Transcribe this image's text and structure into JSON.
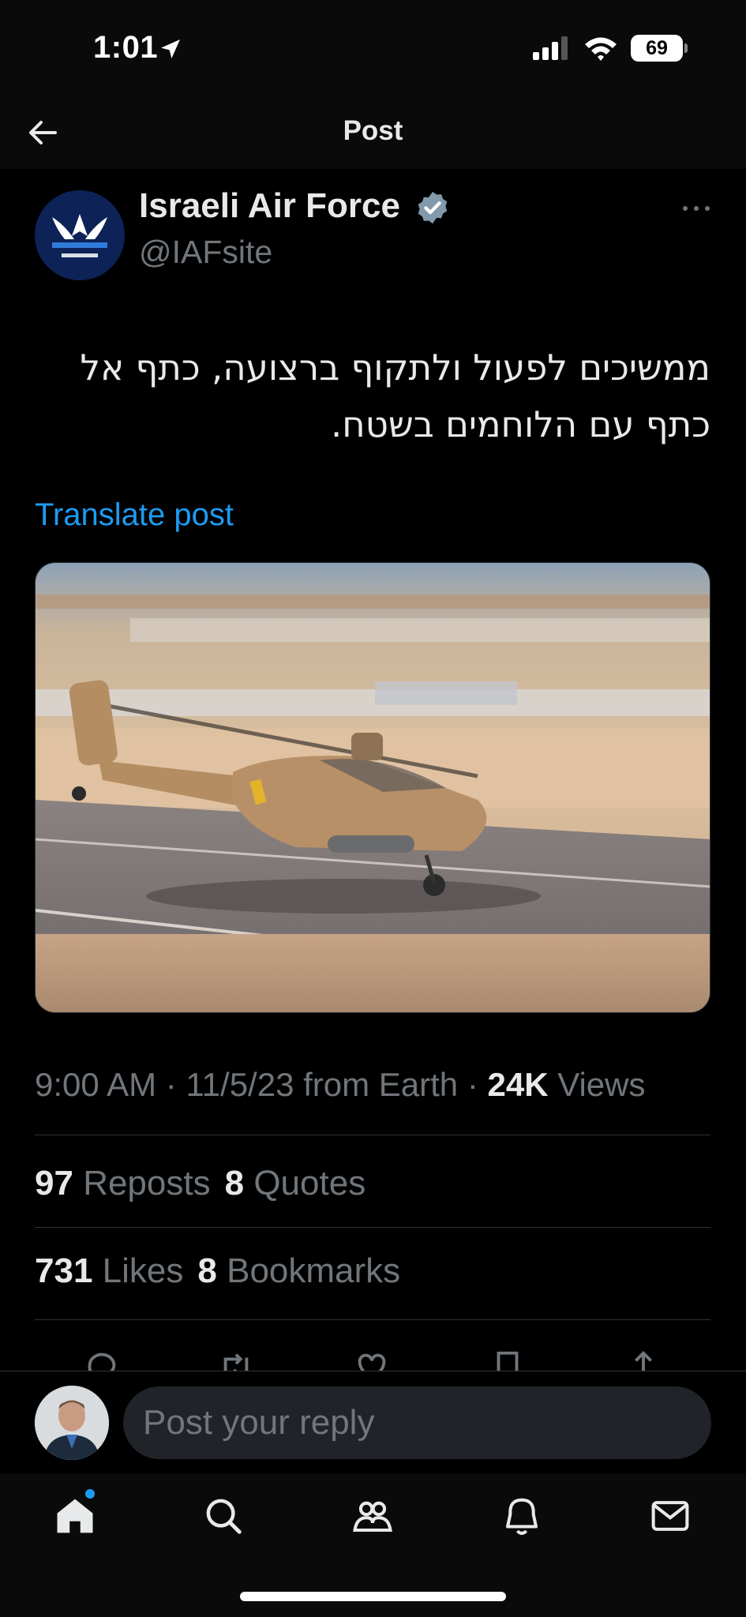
{
  "status_bar": {
    "time": "1:01",
    "battery": "69"
  },
  "header": {
    "title": "Post"
  },
  "post": {
    "author_name": "Israeli Air Force",
    "author_handle": "@IAFsite",
    "text_line1": "ממשיכים לפעול ולתקוף ברצועה, כתף אל",
    "text_line2": "כתף עם הלוחמים בשטח.",
    "translate_label": "Translate post",
    "timestamp": "9:00 AM · 11/5/23 from Earth · ",
    "views_count": "24K",
    "views_label": " Views"
  },
  "stats": {
    "reposts_count": "97",
    "reposts_label": "Reposts",
    "quotes_count": "8",
    "quotes_label": "Quotes",
    "likes_count": "731",
    "likes_label": "Likes",
    "bookmarks_count": "8",
    "bookmarks_label": "Bookmarks"
  },
  "reply": {
    "placeholder": "Post your reply"
  },
  "icons": {
    "status": [
      "location-arrow-icon",
      "signal-icon",
      "wifi-icon",
      "battery-icon"
    ],
    "actions": [
      "reply-icon",
      "repost-icon",
      "like-icon",
      "bookmark-icon",
      "share-icon"
    ],
    "tabs": [
      "home-icon",
      "search-icon",
      "communities-icon",
      "notifications-icon",
      "messages-icon"
    ]
  },
  "colors": {
    "accent": "#1d9bf0",
    "background": "#000000",
    "muted": "#71767b"
  }
}
